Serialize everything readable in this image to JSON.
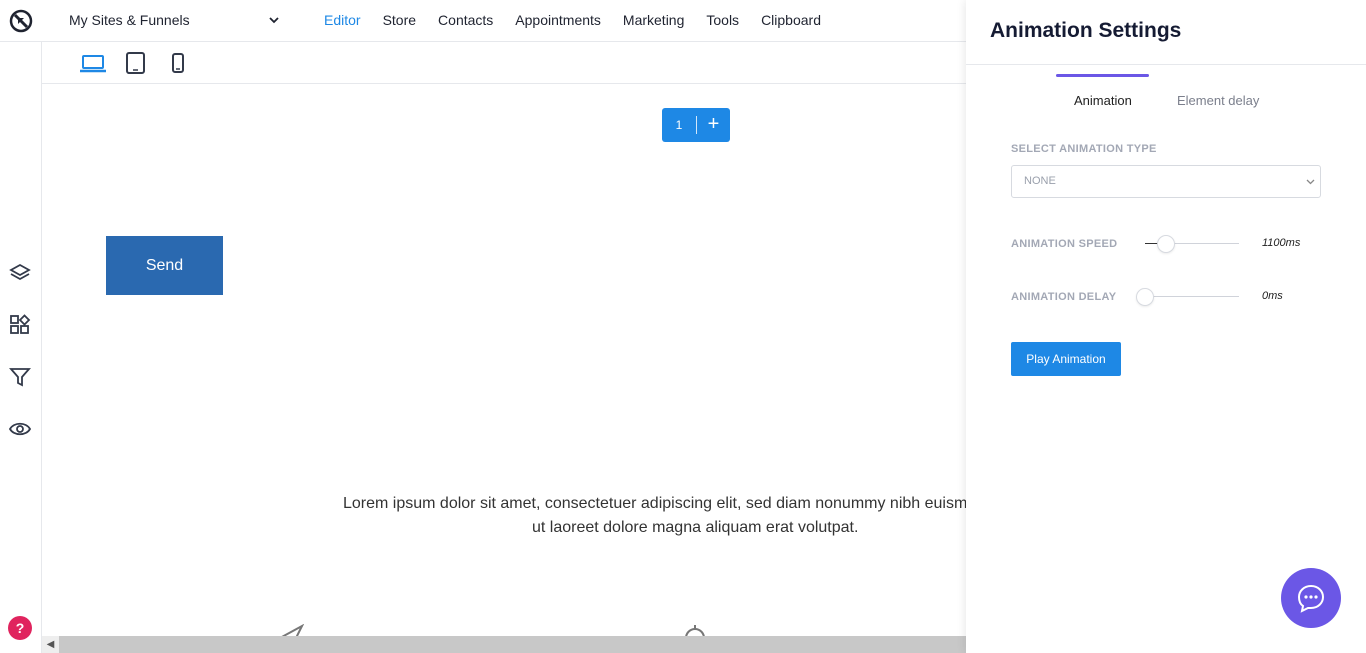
{
  "topbar": {
    "site_selector": "My Sites & Funnels",
    "menu": [
      "Editor",
      "Store",
      "Contacts",
      "Appointments",
      "Marketing",
      "Tools",
      "Clipboard"
    ],
    "active_menu": "Editor"
  },
  "devices": [
    "desktop",
    "tablet",
    "mobile"
  ],
  "canvas": {
    "section_number": "1",
    "section_add": "+",
    "send_label": "Send",
    "lorem_line1": "Lorem ipsum dolor sit amet, consectetuer adipiscing elit, sed diam nonummy nibh euisme",
    "lorem_line2": "ut laoreet dolore magna aliquam erat volutpat."
  },
  "help_label": "?",
  "panel": {
    "title": "Animation Settings",
    "tabs": [
      {
        "label": "Animation",
        "active": true
      },
      {
        "label": "Element delay",
        "active": false
      }
    ],
    "animation_type_label": "SELECT ANIMATION TYPE",
    "animation_type_value": "NONE",
    "speed_label": "ANIMATION SPEED",
    "speed_value": "1100ms",
    "speed_fraction": 0.22,
    "delay_label": "ANIMATION DELAY",
    "delay_value": "0ms",
    "delay_fraction": 0.0,
    "play_label": "Play Animation"
  },
  "colors": {
    "accent": "#1e88e5",
    "tab_indicator": "#6b57e6",
    "send_button": "#2a69b0",
    "help": "#e0245e",
    "chat": "#6b57e6"
  }
}
